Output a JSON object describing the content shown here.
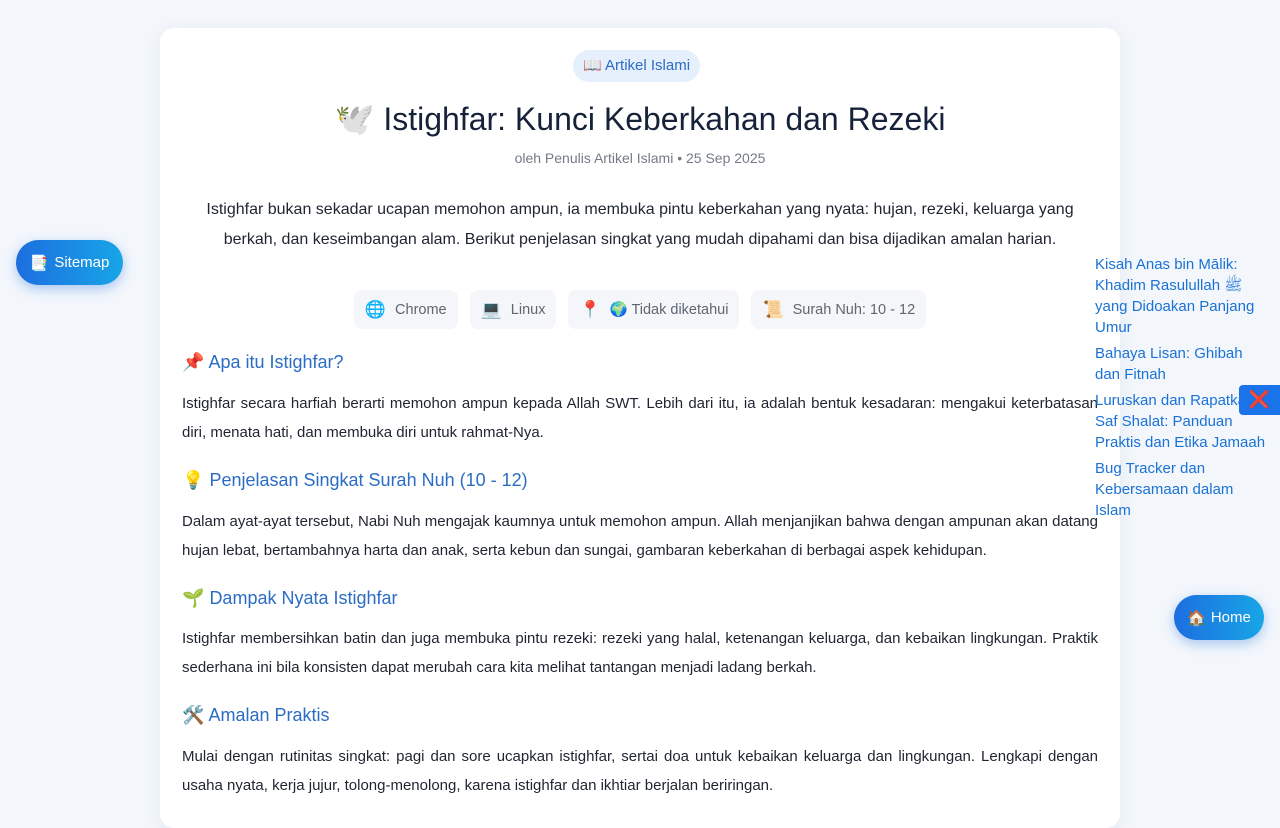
{
  "badge": {
    "icon": "📖",
    "label": "Artikel Islami"
  },
  "article": {
    "title_icon": "🕊️",
    "title": "Istighfar: Kunci Keberkahan dan Rezeki",
    "meta": "oleh Penulis Artikel Islami • 25 Sep 2025",
    "lead": "Istighfar bukan sekadar ucapan memohon ampun, ia membuka pintu keberkahan yang nyata: hujan, rezeki, keluarga yang berkah, dan keseimbangan alam. Berikut penjelasan singkat yang mudah dipahami dan bisa dijadikan amalan harian."
  },
  "chips": [
    {
      "icon": "🌐",
      "label": "Chrome"
    },
    {
      "icon": "💻",
      "label": "Linux"
    },
    {
      "icon": "📍",
      "label": "🌍 Tidak diketahui"
    },
    {
      "icon": "📜",
      "label": "Surah Nuh: 10 - 12"
    }
  ],
  "sections": [
    {
      "icon": "📌",
      "heading": "Apa itu Istighfar?",
      "body": "Istighfar secara harfiah berarti memohon ampun kepada Allah SWT. Lebih dari itu, ia adalah bentuk kesadaran: mengakui keterbatasan diri, menata hati, dan membuka diri untuk rahmat-Nya."
    },
    {
      "icon": "💡",
      "heading": "Penjelasan Singkat Surah Nuh (10 - 12)",
      "body": "Dalam ayat-ayat tersebut, Nabi Nuh mengajak kaumnya untuk memohon ampun. Allah menjanjikan bahwa dengan ampunan akan datang hujan lebat, bertambahnya harta dan anak, serta kebun dan sungai, gambaran keberkahan di berbagai aspek kehidupan."
    },
    {
      "icon": "🌱",
      "heading": "Dampak Nyata Istighfar",
      "body": "Istighfar membersihkan batin dan juga membuka pintu rezeki: rezeki yang halal, ketenangan keluarga, dan kebaikan lingkungan. Praktik sederhana ini bila konsisten dapat merubah cara kita melihat tantangan menjadi ladang berkah."
    },
    {
      "icon": "🛠️",
      "heading": "Amalan Praktis",
      "body": "Mulai dengan rutinitas singkat: pagi dan sore ucapkan istighfar, sertai doa untuk kebaikan keluarga dan lingkungan. Lengkapi dengan usaha nyata, kerja jujur, tolong-menolong, karena istighfar dan ikhtiar berjalan beriringan."
    }
  ],
  "sitemap_button": {
    "icon": "📑",
    "label": "Sitemap"
  },
  "home_button": {
    "icon": "🏠",
    "label": "Home"
  },
  "close_button": {
    "icon": "❌"
  },
  "related_links": [
    "Kisah Anas bin Mālik: Khadim Rasulullah ﷺ yang Didoakan Panjang Umur",
    "Bahaya Lisan: Ghibah dan Fitnah",
    "Luruskan dan Rapatkan Saf Shalat: Panduan Praktis dan Etika Jamaah",
    "Bug Tracker dan Kebersamaan dalam Islam"
  ]
}
